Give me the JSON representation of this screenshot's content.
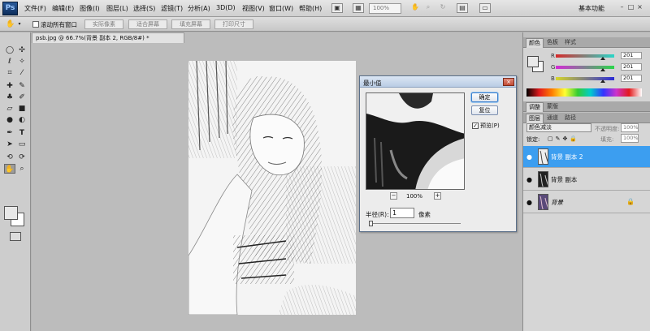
{
  "app": {
    "logo": "Ps"
  },
  "menu": [
    "文件(F)",
    "编辑(E)",
    "图像(I)",
    "图层(L)",
    "选择(S)",
    "滤镜(T)",
    "分析(A)",
    "3D(D)",
    "视图(V)",
    "窗口(W)",
    "帮助(H)"
  ],
  "toolbar": {
    "zoom": "100%",
    "workspace": "基本功能",
    "win_controls": [
      "–",
      "□",
      "×"
    ]
  },
  "options": {
    "tool_icon": "hand-icon",
    "scroll_all": "滚动所有窗口",
    "buttons": [
      "实际像素",
      "适合屏幕",
      "填充屏幕",
      "打印尺寸"
    ]
  },
  "document": {
    "tab": "psb.jpg @ 66.7%(背景 副本 2, RGB/8#) *",
    "close": "×"
  },
  "dialog": {
    "title": "最小值",
    "close": "×",
    "ok": "确定",
    "reset": "复位",
    "preview_checked": "✓",
    "preview_label": "预览(P)",
    "zoom_minus": "−",
    "zoom_plus": "+",
    "zoom": "100%",
    "radius_label": "半径(R):",
    "radius_value": "1",
    "radius_unit": "像素",
    "radius_fraction": 0.0
  },
  "color_panel": {
    "tabs": [
      "颜色",
      "色板",
      "样式"
    ],
    "sliders": [
      {
        "label": "R",
        "value": "201",
        "start": "#d62a2a",
        "end": "#2ad6c8",
        "fraction": 0.79
      },
      {
        "label": "G",
        "value": "201",
        "start": "#d42ad6",
        "end": "#2ad64a",
        "fraction": 0.79
      },
      {
        "label": "B",
        "value": "201",
        "start": "#d6d62a",
        "end": "#2a2ad6",
        "fraction": 0.79
      }
    ]
  },
  "adjust_tabs": [
    "调整",
    "蒙版"
  ],
  "layers_panel": {
    "tabs": [
      "图层",
      "通道",
      "路径"
    ],
    "blend_mode": "颜色减淡",
    "opacity_label": "不透明度:",
    "opacity": "100%",
    "lock_label": "锁定:",
    "fill_label": "填充:",
    "fill": "100%",
    "layers": [
      {
        "name": "背景 副本 2",
        "selected": true,
        "visible_icon": "●",
        "lock": ""
      },
      {
        "name": "背景 副本",
        "selected": false,
        "visible_icon": "●",
        "lock": ""
      },
      {
        "name": "背景",
        "selected": false,
        "visible_icon": "●",
        "lock": "🔒"
      }
    ]
  },
  "colors": {
    "accent": "#3c9ef0",
    "canvas_bg": "#bcbcbc",
    "panel_bg": "#d6d6d6"
  }
}
